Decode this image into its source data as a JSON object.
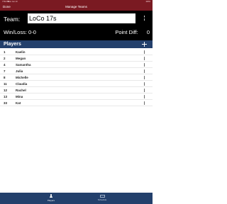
{
  "status_bar": {
    "time": "7:59 PM",
    "date": "Mon Jun 10",
    "battery": "100%"
  },
  "nav": {
    "done_label": "Done",
    "title": "Manage Teams"
  },
  "team": {
    "label": "Team:",
    "name_value": "LoCo 17s",
    "winloss_label": "Win/Loss:",
    "winloss_value": "0-0",
    "pointdiff_label": "Point Diff:",
    "pointdiff_value": "0"
  },
  "players": {
    "header": "Players",
    "items": [
      {
        "number": "1",
        "name": "Kaelin"
      },
      {
        "number": "2",
        "name": "Megan"
      },
      {
        "number": "4",
        "name": "Samantha"
      },
      {
        "number": "7",
        "name": "Julia"
      },
      {
        "number": "8",
        "name": "Michelle"
      },
      {
        "number": "11",
        "name": "Claudia"
      },
      {
        "number": "12",
        "name": "Rachel"
      },
      {
        "number": "13",
        "name": "Mina"
      },
      {
        "number": "33",
        "name": "Kat"
      }
    ]
  },
  "tabs": [
    {
      "label": "Players",
      "icon": "person-icon"
    },
    {
      "label": "Schedule",
      "icon": "grid-icon"
    }
  ],
  "colors": {
    "nav_bar": "#7a1a22",
    "header": "#000000",
    "section_header": "#23406c",
    "tab_bar": "#23406c"
  }
}
